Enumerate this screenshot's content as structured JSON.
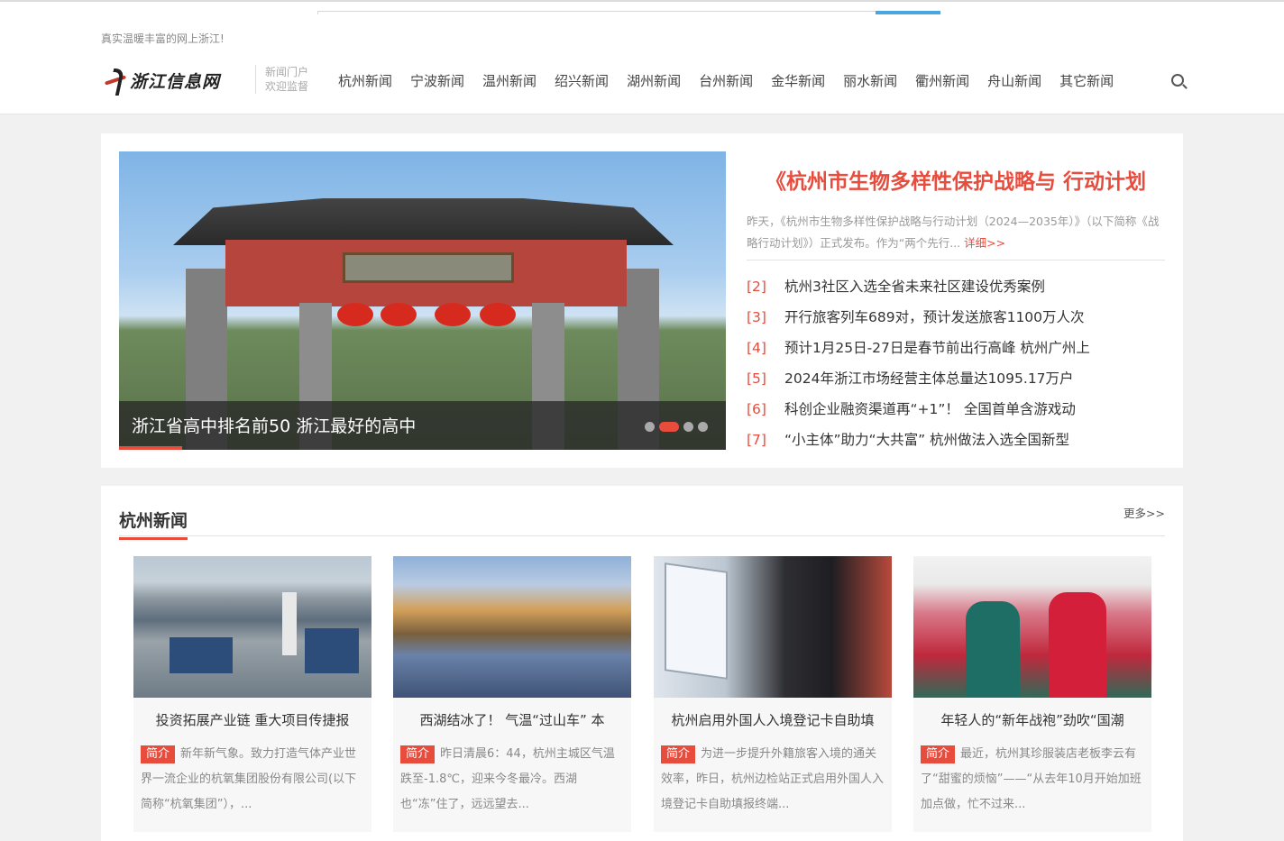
{
  "header": {
    "slogan": "真实温暖丰富的网上浙江!",
    "logo_text": "浙江信息网",
    "portal_line1": "新闻门户",
    "portal_line2": "欢迎监督",
    "nav": [
      "杭州新闻",
      "宁波新闻",
      "温州新闻",
      "绍兴新闻",
      "湖州新闻",
      "台州新闻",
      "金华新闻",
      "丽水新闻",
      "衢州新闻",
      "舟山新闻",
      "其它新闻"
    ]
  },
  "slider": {
    "caption": "浙江省高中排名前50 浙江最好的高中",
    "active_index": 1,
    "slide_count": 4
  },
  "featured": {
    "headline": "《杭州市生物多样性保护战略与 行动计划",
    "summary": "昨天，《杭州市生物多样性保护战略与行动计划（2024—2035年）》（以下简称《战略行动计划》）正式发布。作为“两个先行...",
    "more": "详细>>",
    "items": [
      {
        "num": "[2]",
        "text": "杭州3社区入选全省未来社区建设优秀案例"
      },
      {
        "num": "[3]",
        "text": "开行旅客列车689对，预计发送旅客1100万人次"
      },
      {
        "num": "[4]",
        "text": "预计1月25日-27日是春节前出行高峰 杭州广州上"
      },
      {
        "num": "[5]",
        "text": "2024年浙江市场经营主体总量达1095.17万户"
      },
      {
        "num": "[6]",
        "text": "科创企业融资渠道再“+1”！ 全国首单含游戏动"
      },
      {
        "num": "[7]",
        "text": "“小主体”助力“大共富” 杭州做法入选全国新型"
      }
    ]
  },
  "section": {
    "title": "杭州新闻",
    "more": "更多>>",
    "tag": "简介",
    "cards": [
      {
        "title": "投资拓展产业链 重大项目传捷报",
        "intro": "新年新气象。致力打造气体产业世界一流企业的杭氧集团股份有限公司(以下简称“杭氧集团”），..."
      },
      {
        "title": "西湖结冰了！ 气温“过山车” 本",
        "intro": "昨日清晨6：44，杭州主城区气温跌至-1.8℃，迎来今冬最冷。西湖也“冻”住了，远远望去..."
      },
      {
        "title": "杭州启用外国人入境登记卡自助填",
        "intro": "为进一步提升外籍旅客入境的通关效率，昨日，杭州边检站正式启用外国人入境登记卡自助填报终端..."
      },
      {
        "title": "年轻人的“新年战袍”劲吹“国潮",
        "intro": "最近，杭州其珍服装店老板李云有了“甜蜜的烦恼”——“从去年10月开始加班加点做，忙不过来..."
      }
    ]
  },
  "colors": {
    "accent": "#e84c3d",
    "search_button": "#4aa6e0"
  }
}
